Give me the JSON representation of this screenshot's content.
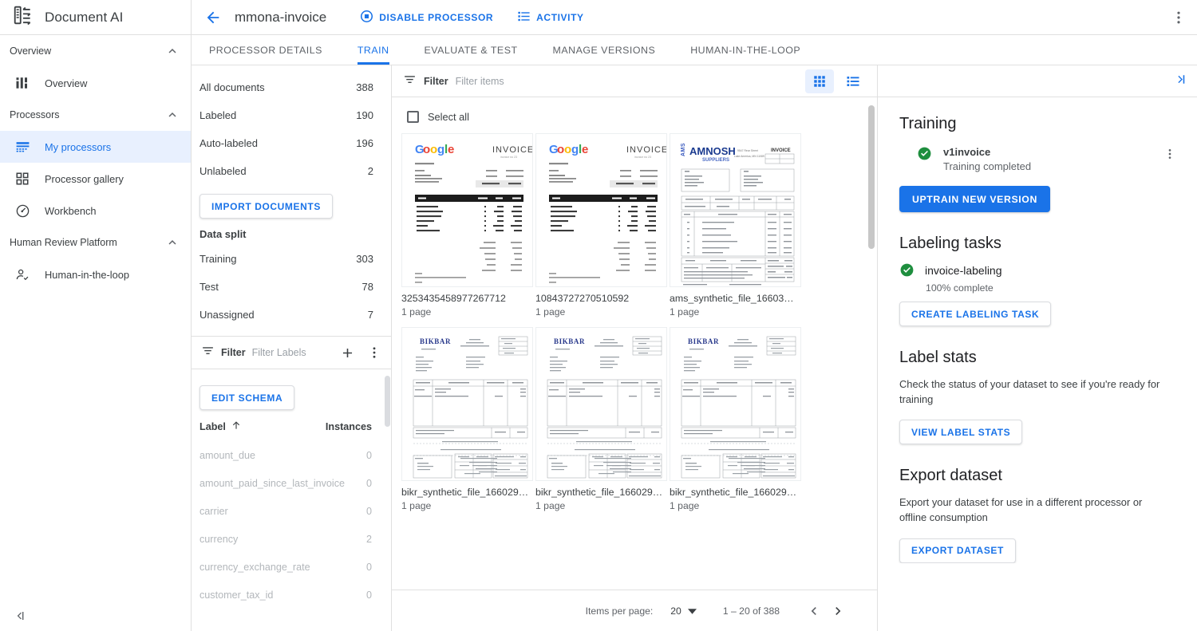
{
  "brand": {
    "title": "Document AI",
    "logo_icon": "document-ai-logo-icon"
  },
  "sidebar": {
    "sections": [
      {
        "label": "Overview",
        "collapse_icon": "chevron-up-icon"
      },
      {
        "label": "Processors",
        "collapse_icon": "chevron-up-icon"
      },
      {
        "label": "Human Review Platform",
        "collapse_icon": "chevron-up-icon"
      }
    ],
    "items": [
      {
        "label": "Overview",
        "icon": "dashboard-icon",
        "active": false
      },
      {
        "label": "My processors",
        "icon": "processor-list-icon",
        "active": true
      },
      {
        "label": "Processor gallery",
        "icon": "grid-gallery-icon",
        "active": false
      },
      {
        "label": "Workbench",
        "icon": "workbench-clock-icon",
        "active": false
      },
      {
        "label": "Human-in-the-loop",
        "icon": "person-check-icon",
        "active": false
      }
    ],
    "collapse_label": "collapse-nav-icon"
  },
  "topbar": {
    "back_icon": "arrow-back-icon",
    "processor_name": "mmona-invoice",
    "actions": [
      {
        "label": "DISABLE PROCESSOR",
        "icon": "stop-circle-icon"
      },
      {
        "label": "ACTIVITY",
        "icon": "activity-list-icon"
      }
    ],
    "more_icon": "more-vert-icon"
  },
  "tabs": [
    {
      "label": "PROCESSOR DETAILS",
      "active": false
    },
    {
      "label": "TRAIN",
      "active": true
    },
    {
      "label": "EVALUATE & TEST",
      "active": false
    },
    {
      "label": "MANAGE VERSIONS",
      "active": false
    },
    {
      "label": "HUMAN-IN-THE-LOOP",
      "active": false
    }
  ],
  "dataset": {
    "stats": [
      {
        "label": "All documents",
        "value": "388"
      },
      {
        "label": "Labeled",
        "value": "190"
      },
      {
        "label": "Auto-labeled",
        "value": "196"
      },
      {
        "label": "Unlabeled",
        "value": "2"
      }
    ],
    "import_button": "IMPORT DOCUMENTS",
    "data_split_title": "Data split",
    "splits": [
      {
        "label": "Training",
        "value": "303"
      },
      {
        "label": "Test",
        "value": "78"
      },
      {
        "label": "Unassigned",
        "value": "7"
      }
    ],
    "filter": {
      "icon": "filter-icon",
      "label": "Filter",
      "placeholder": "Filter Labels"
    },
    "add_icon": "add-icon",
    "more_icon": "more-vert-icon",
    "edit_schema_button": "EDIT SCHEMA",
    "label_column": "Label",
    "sort_icon": "arrow-up-icon",
    "instances_column": "Instances",
    "labels": [
      {
        "name": "amount_due",
        "instances": "0"
      },
      {
        "name": "amount_paid_since_last_invoice",
        "instances": "0"
      },
      {
        "name": "carrier",
        "instances": "0"
      },
      {
        "name": "currency",
        "instances": "2"
      },
      {
        "name": "currency_exchange_rate",
        "instances": "0"
      },
      {
        "name": "customer_tax_id",
        "instances": "0"
      }
    ]
  },
  "documents": {
    "filter": {
      "icon": "filter-icon",
      "label": "Filter",
      "placeholder": "Filter items"
    },
    "view_grid_icon": "grid-view-icon",
    "view_list_icon": "list-view-icon",
    "select_all_label": "Select all",
    "items": [
      {
        "name": "3253435458977267712",
        "pages": "1 page",
        "thumb": "google-invoice"
      },
      {
        "name": "10843727270510592",
        "pages": "1 page",
        "thumb": "google-invoice"
      },
      {
        "name": "ams_synthetic_file_1660305…",
        "pages": "1 page",
        "thumb": "amnosh-invoice"
      },
      {
        "name": "bikr_synthetic_file_1660293…",
        "pages": "1 page",
        "thumb": "bikbar-invoice"
      },
      {
        "name": "bikr_synthetic_file_1660293…",
        "pages": "1 page",
        "thumb": "bikbar-invoice"
      },
      {
        "name": "bikr_synthetic_file_1660294…",
        "pages": "1 page",
        "thumb": "bikbar-invoice"
      }
    ],
    "paginator": {
      "items_per_page_label": "Items per page:",
      "page_size": "20",
      "dropdown_icon": "arrow-drop-down-icon",
      "range": "1 – 20 of 388",
      "prev_icon": "chevron-left-icon",
      "next_icon": "chevron-right-icon"
    }
  },
  "right_panel": {
    "expand_icon": "panel-expand-icon",
    "training": {
      "title": "Training",
      "status_icon": "check-circle-icon",
      "version_name": "v1invoice",
      "version_status": "Training completed",
      "more_icon": "more-vert-icon",
      "uptrain_button": "UPTRAIN NEW VERSION"
    },
    "labeling_tasks": {
      "title": "Labeling tasks",
      "status_icon": "check-circle-icon",
      "task_name": "invoice-labeling",
      "task_progress": "100% complete",
      "create_button": "CREATE LABELING TASK"
    },
    "label_stats": {
      "title": "Label stats",
      "description": "Check the status of your dataset to see if you're ready for training",
      "button": "VIEW LABEL STATS"
    },
    "export_dataset": {
      "title": "Export dataset",
      "description": "Export your dataset for use in a different processor or offline consumption",
      "button": "EXPORT DATASET"
    }
  },
  "colors": {
    "accent_blue": "#1a73e8",
    "active_bg": "#e8f0fe",
    "success_green": "#34a853",
    "text_primary": "#3c4043",
    "text_secondary": "#5f6368",
    "border": "#e0e0e0"
  }
}
